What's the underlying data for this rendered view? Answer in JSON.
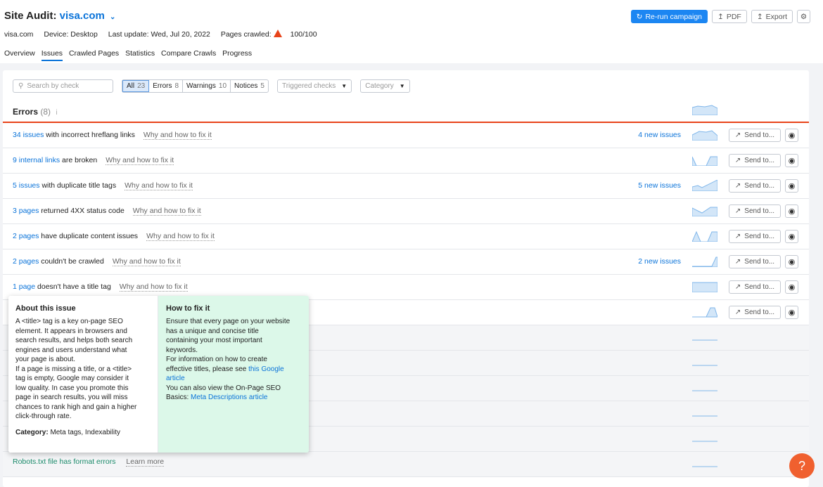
{
  "header": {
    "title_prefix": "Site Audit:",
    "domain": "visa.com",
    "site": "visa.com",
    "device": "Device: Desktop",
    "last_update": "Last update: Wed, Jul 20, 2022",
    "pages_crawled_label": "Pages crawled:",
    "pages_crawled_value": "100/100",
    "rerun_label": "Re-run campaign",
    "pdf_label": "PDF",
    "export_label": "Export"
  },
  "tabs": [
    "Overview",
    "Issues",
    "Crawled Pages",
    "Statistics",
    "Compare Crawls",
    "Progress"
  ],
  "filters": {
    "search_placeholder": "Search by check",
    "segments": [
      {
        "label": "All",
        "count": "23"
      },
      {
        "label": "Errors",
        "count": "8"
      },
      {
        "label": "Warnings",
        "count": "10"
      },
      {
        "label": "Notices",
        "count": "5"
      }
    ],
    "triggered_checks": "Triggered checks",
    "category": "Category"
  },
  "errors_section": {
    "label": "Errors",
    "count": "(8)",
    "info": "i"
  },
  "rows": [
    {
      "link": "34 issues",
      "text": " with incorrect hreflang links",
      "why": "Why and how to fix it",
      "new": "4 new issues"
    },
    {
      "link": "9 internal links",
      "text": " are broken",
      "why": "Why and how to fix it",
      "new": ""
    },
    {
      "link": "5 issues",
      "text": " with duplicate title tags",
      "why": "Why and how to fix it",
      "new": "5 new issues"
    },
    {
      "link": "3 pages",
      "text": " returned 4XX status code",
      "why": "Why and how to fix it",
      "new": ""
    },
    {
      "link": "2 pages",
      "text": " have duplicate content issues",
      "why": "Why and how to fix it",
      "new": ""
    },
    {
      "link": "2 pages",
      "text": " couldn't be crawled",
      "why": "Why and how to fix it",
      "new": "2 new issues"
    },
    {
      "link": "1 page",
      "text": " doesn't have a title tag",
      "why": "Why and how to fix it",
      "new": ""
    },
    {
      "link": "",
      "text": "",
      "why": "",
      "new": ""
    }
  ],
  "send_label": "Send to...",
  "robots": {
    "text": "Robots.txt file has format errors",
    "learn": "Learn more"
  },
  "popup": {
    "about_title": "About this issue",
    "about_text": "A <title> tag is a key on-page SEO\nelement. It appears in browsers and\nsearch results, and helps both search\nengines and users understand what\nyour page is about.\nIf a page is missing a title, or a <title>\ntag is empty, Google may consider it\nlow quality. In case you promote this\npage in search results, you will miss\nchances to rank high and gain a higher\nclick-through rate.",
    "category_label": "Category:",
    "category_value": "Meta tags, Indexability",
    "fix_title": "How to fix it",
    "fix_text_1": "Ensure that every page on your website\nhas a unique and concise title\ncontaining your most important\nkeywords.\nFor information on how to create\neffective titles, please see ",
    "fix_link_1": "this Google\narticle",
    "fix_text_2": "\nYou can also view the On-Page SEO\nBasics: ",
    "fix_link_2": "Meta Descriptions article"
  },
  "help_label": "?"
}
